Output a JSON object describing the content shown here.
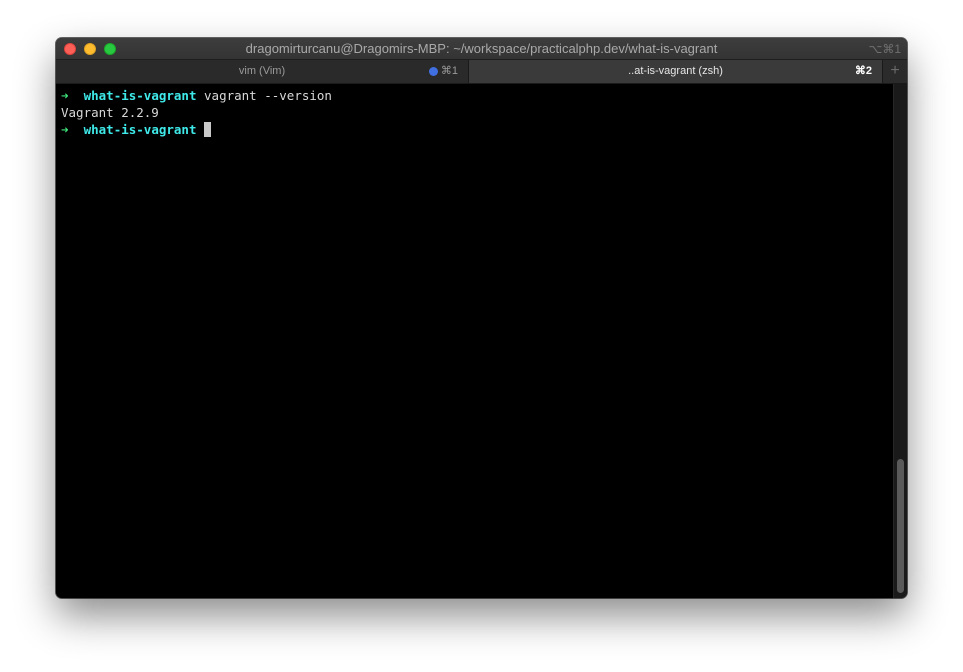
{
  "window": {
    "title": "dragomirturcanu@Dragomirs-MBP: ~/workspace/practicalphp.dev/what-is-vagrant",
    "title_shortcut": "⌥⌘1"
  },
  "tabs": [
    {
      "label": "vim (Vim)",
      "shortcut": "⌘1",
      "active": false,
      "has_activity": true
    },
    {
      "label": "..at-is-vagrant (zsh)",
      "shortcut": "⌘2",
      "active": true
    }
  ],
  "new_tab_label": "+",
  "terminal": {
    "prompt_symbol": "➜",
    "prompt_dir": "what-is-vagrant",
    "lines": [
      {
        "type": "prompt",
        "command": "vagrant --version"
      },
      {
        "type": "output",
        "text": "Vagrant 2.2.9"
      },
      {
        "type": "prompt",
        "command": ""
      }
    ]
  },
  "colors": {
    "prompt_arrow": "#3fe27a",
    "prompt_dir": "#3fe9e9",
    "activity_dot": "#3f6fe0"
  }
}
